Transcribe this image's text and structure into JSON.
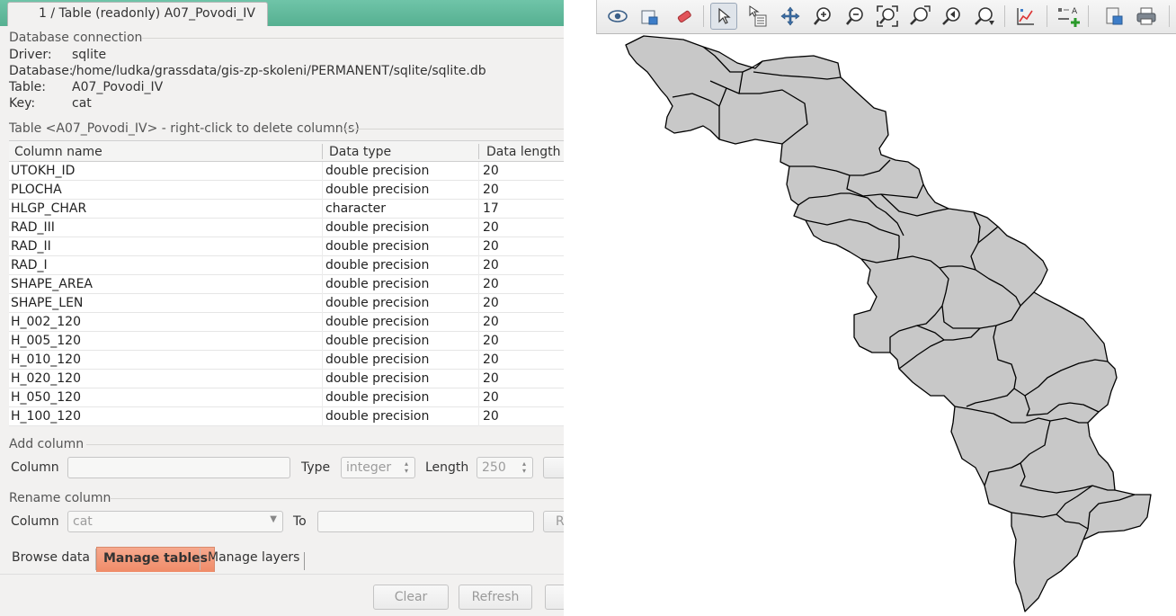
{
  "tab": {
    "title": "1 / Table (readonly) A07_Povodi_IV"
  },
  "connection": {
    "title": "Database connection",
    "driver_label": "Driver:",
    "driver": "sqlite",
    "database_label": "Database:",
    "database": "/home/ludka/grassdata/gis-zp-skoleni/PERMANENT/sqlite/sqlite.db",
    "table_label": "Table:",
    "table": "A07_Povodi_IV",
    "key_label": "Key:",
    "key": "cat"
  },
  "columns_group": {
    "title": "Table <A07_Povodi_IV> - right-click to delete column(s)",
    "headers": [
      "Column name",
      "Data type",
      "Data length"
    ],
    "rows": [
      [
        "UTOKH_ID",
        "double precision",
        "20"
      ],
      [
        "PLOCHA",
        "double precision",
        "20"
      ],
      [
        "HLGP_CHAR",
        "character",
        "17"
      ],
      [
        "RAD_III",
        "double precision",
        "20"
      ],
      [
        "RAD_II",
        "double precision",
        "20"
      ],
      [
        "RAD_I",
        "double precision",
        "20"
      ],
      [
        "SHAPE_AREA",
        "double precision",
        "20"
      ],
      [
        "SHAPE_LEN",
        "double precision",
        "20"
      ],
      [
        "H_002_120",
        "double precision",
        "20"
      ],
      [
        "H_005_120",
        "double precision",
        "20"
      ],
      [
        "H_010_120",
        "double precision",
        "20"
      ],
      [
        "H_020_120",
        "double precision",
        "20"
      ],
      [
        "H_050_120",
        "double precision",
        "20"
      ],
      [
        "H_100_120",
        "double precision",
        "20"
      ]
    ]
  },
  "add_column": {
    "title": "Add column",
    "column_label": "Column",
    "column_value": "",
    "type_label": "Type",
    "type_value": "integer",
    "length_label": "Length",
    "length_value": "250"
  },
  "rename_column": {
    "title": "Rename column",
    "column_label": "Column",
    "column_value": "cat",
    "to_label": "To",
    "to_value": "",
    "button_partial": "R"
  },
  "bottom_tabs": [
    "Browse data",
    "Manage tables",
    "Manage layers"
  ],
  "buttons": {
    "clear": "Clear",
    "refresh": "Refresh"
  },
  "toolbar": {
    "icons": [
      "display-map-icon",
      "render-map-icon",
      "erase-display-icon",
      "pointer-icon",
      "query-icon",
      "pan-icon",
      "zoom-in-icon",
      "zoom-out-icon",
      "zoom-extent-icon",
      "zoom-region-icon",
      "zoom-back-icon",
      "zoom-options-icon",
      "analyze-icon",
      "overlay-icon",
      "save-display-icon",
      "print-icon"
    ]
  },
  "map": {
    "fill": "#c8c8c8",
    "stroke": "#000000"
  }
}
